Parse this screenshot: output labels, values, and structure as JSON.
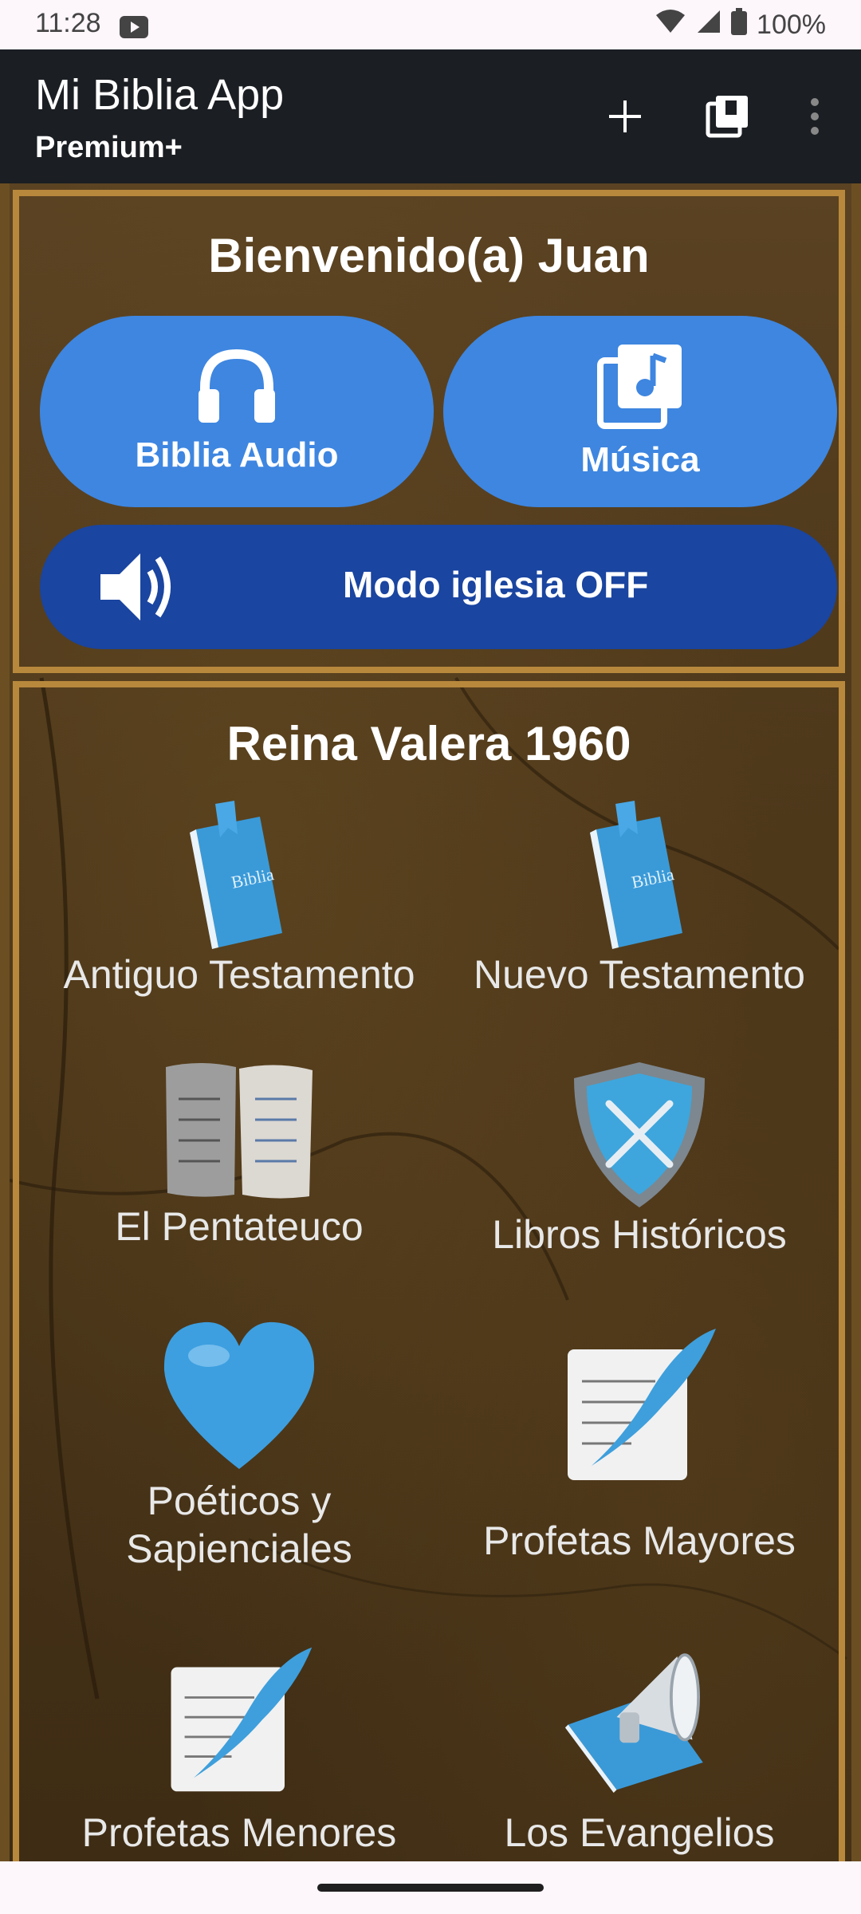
{
  "status_bar": {
    "time": "11:28",
    "battery": "100%"
  },
  "app_bar": {
    "title": "Mi Biblia App",
    "subtitle": "Premium+",
    "icons": [
      "add-icon",
      "library-icon",
      "more-vert-icon"
    ]
  },
  "welcome": {
    "text": "Bienvenido(a) Juan"
  },
  "buttons": {
    "audio_label": "Biblia Audio",
    "music_label": "Música",
    "church_mode_label": "Modo iglesia OFF"
  },
  "section": {
    "title": "Reina Valera 1960",
    "tiles": [
      {
        "label": "Antiguo Testamento",
        "icon": "bible-book-icon"
      },
      {
        "label": "Nuevo Testamento",
        "icon": "bible-book-icon"
      },
      {
        "label": "El Pentateuco",
        "icon": "stone-tablets-icon"
      },
      {
        "label": "Libros Históricos",
        "icon": "shield-swords-icon"
      },
      {
        "label": "Poéticos y Sapienciales",
        "icon": "heart-icon"
      },
      {
        "label": "Profetas Mayores",
        "icon": "quill-document-icon"
      },
      {
        "label": "Profetas Menores",
        "icon": "quill-document-icon"
      },
      {
        "label": "Los Evangelios",
        "icon": "book-megaphone-icon"
      }
    ]
  },
  "colors": {
    "app_bar": "#1b1e22",
    "pill_blue": "#3e86e0",
    "church_blue": "#1a45a0",
    "frame": "#b8883c"
  }
}
